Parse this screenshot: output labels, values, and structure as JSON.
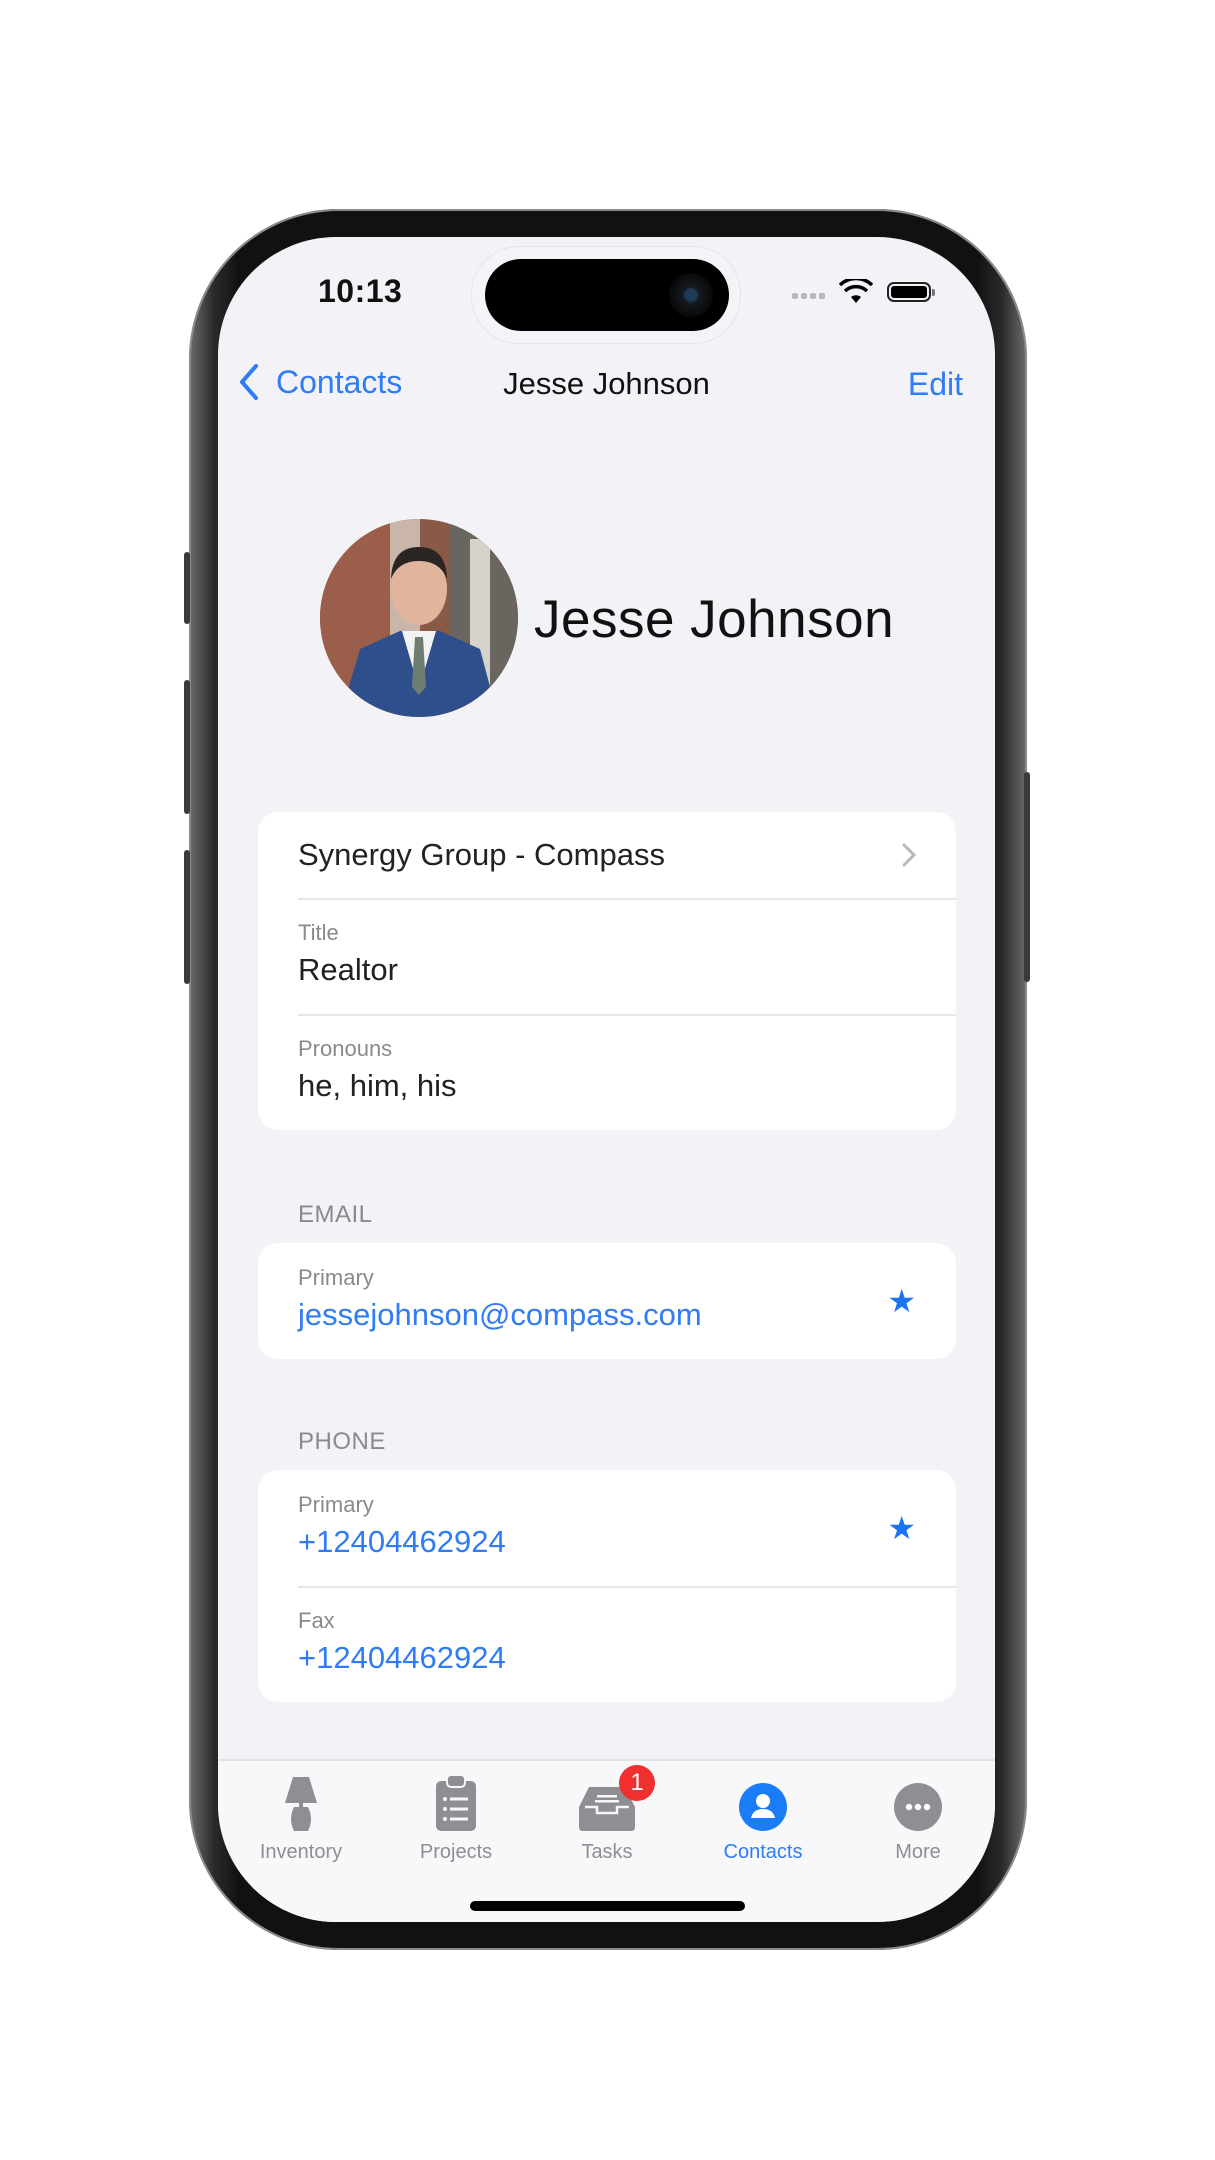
{
  "status_bar": {
    "time": "10:13"
  },
  "nav": {
    "back_label": "Contacts",
    "title": "Jesse Johnson",
    "edit_label": "Edit"
  },
  "profile": {
    "name": "Jesse Johnson",
    "avatar": "profile-photo"
  },
  "details": {
    "company": "Synergy Group - Compass",
    "title_label": "Title",
    "title_value": "Realtor",
    "pronouns_label": "Pronouns",
    "pronouns_value": "he, him, his"
  },
  "email": {
    "section_label": "EMAIL",
    "items": [
      {
        "label": "Primary",
        "value": "jessejohnson@compass.com",
        "starred": true
      }
    ]
  },
  "phone": {
    "section_label": "PHONE",
    "items": [
      {
        "label": "Primary",
        "value": "+12404462924",
        "starred": true
      },
      {
        "label": "Fax",
        "value": "+12404462924",
        "starred": false
      }
    ]
  },
  "tabbar": {
    "items": [
      {
        "label": "Inventory",
        "icon": "lamp-icon",
        "active": false
      },
      {
        "label": "Projects",
        "icon": "clipboard-icon",
        "active": false
      },
      {
        "label": "Tasks",
        "icon": "inbox-tray-icon",
        "active": false,
        "badge": "1"
      },
      {
        "label": "Contacts",
        "icon": "person-circle-icon",
        "active": true
      },
      {
        "label": "More",
        "icon": "ellipsis-circle-icon",
        "active": false
      }
    ]
  },
  "colors": {
    "accent": "#2f7cf6",
    "badge": "#f0302f",
    "background": "#f2f2f7"
  }
}
